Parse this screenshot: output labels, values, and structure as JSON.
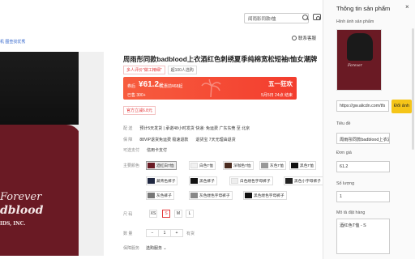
{
  "header": {
    "search_value": "闻雨影同款t恤",
    "breadcrumb": "机 图查找优秀"
  },
  "product": {
    "title": "周雨彤同款badblood上衣酒红色刺绣夏季纯棉宽松短袖t恤女潮牌",
    "favorite_label": "联系客服",
    "tags": [
      "多人评价\"做工精细\"",
      "超100人选购"
    ],
    "price_prefix": "券后",
    "price_value": "61.2",
    "price_unit": "起",
    "price_note": "优惠前¥68起",
    "sold": "已售 300+",
    "sale_name": "五一狂欢",
    "sale_time": "5月5日 24点 结束",
    "coupon": "官方立减6.8元",
    "ship_label": "配 送",
    "ship_value": "预计5天发货  |  承诺48小时发货  快递: 免运费  广东东莞  至 北京",
    "guarantee_label": "保 障",
    "guarantee_value": "退货宝  7天无理由退货",
    "guarantee_badge": "88VIP退货免运费  极速退款",
    "installment_label": "可选支付",
    "installment_value": "信用卡支付",
    "color_label": "主要颜色",
    "colors": [
      "酒红白T恤",
      "白色T恤",
      "深咖色T恤",
      "灰色T恤",
      "黑色T恤",
      "藏青色裤子",
      "黑色裤子",
      "白色缕色字母裤子",
      "黑色小字母裤子",
      "灰色裤子",
      "灰色缕色字母裤子",
      "黑色缕色字母裤子"
    ],
    "size_label": "尺 码",
    "sizes": [
      "XS",
      "S",
      "M",
      "L"
    ],
    "selected_size": "S",
    "qty_label": "数 量",
    "qty_value": "1",
    "qty_stock": "有货",
    "service_label": "保障服务",
    "service_value": "选购服务"
  },
  "panel": {
    "title": "Thông tin sản phẩm",
    "close_icon": "close-icon",
    "image_label": "Hình ảnh sản phẩm",
    "url_value": "https://gw.alicdn.com/tfs",
    "url_button": "Đổi ảnh",
    "title_label": "Tiêu đề",
    "title_value": "周雨彤同款badblood上衣酒红色刺绣",
    "price_label": "Đơn giá",
    "price_value": "61.2",
    "qty_label": "Số lượng",
    "qty_value": "1",
    "desc_label": "Mô tả đặt hàng",
    "desc_value": "酒红色T恤 - S"
  },
  "colors": {
    "accent": "#f33d2e",
    "shirt": "#6a1a24",
    "button": "#f5c518"
  }
}
